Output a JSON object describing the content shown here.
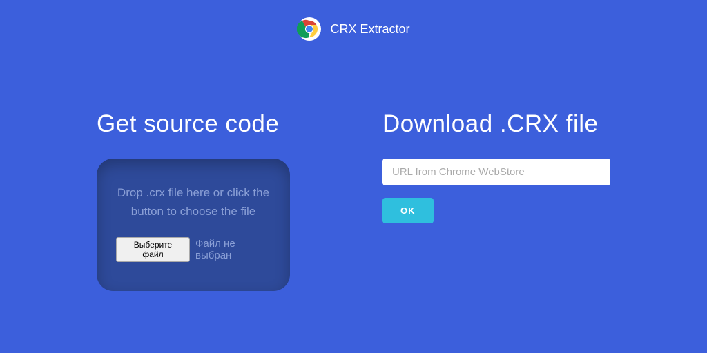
{
  "header": {
    "title": "CRX Extractor"
  },
  "left": {
    "title": "Get source code",
    "dropzone_text": "Drop .crx file here or click the button to choose the file",
    "file_button_label": "Выберите файл",
    "file_status": "Файл не выбран"
  },
  "right": {
    "title": "Download .CRX file",
    "url_placeholder": "URL from Chrome WebStore",
    "ok_label": "OK"
  }
}
